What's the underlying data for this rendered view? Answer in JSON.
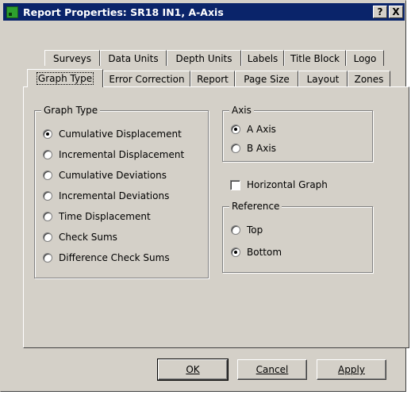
{
  "window": {
    "title": "Report Properties: SR18 IN1, A-Axis",
    "help_label": "?",
    "close_label": "X"
  },
  "tabs_row1": [
    "Surveys",
    "Data Units",
    "Depth Units",
    "Labels",
    "Title Block",
    "Logo"
  ],
  "tabs_row2": [
    "Graph Type",
    "Error Correction",
    "Report",
    "Page Size",
    "Layout",
    "Zones"
  ],
  "active_tab": "Graph Type",
  "graph_type": {
    "label": "Graph Type",
    "options": [
      "Cumulative Displacement",
      "Incremental Displacement",
      "Cumulative Deviations",
      "Incremental Deviations",
      "Time Displacement",
      "Check Sums",
      "Difference Check Sums"
    ],
    "selected": "Cumulative Displacement"
  },
  "axis": {
    "label": "Axis",
    "options": [
      "A Axis",
      "B Axis"
    ],
    "selected": "A Axis"
  },
  "horizontal_graph": {
    "label": "Horizontal Graph",
    "checked": false
  },
  "reference": {
    "label": "Reference",
    "options": [
      "Top",
      "Bottom"
    ],
    "selected": "Bottom"
  },
  "buttons": {
    "ok": "OK",
    "cancel": "Cancel",
    "apply": "Apply"
  }
}
